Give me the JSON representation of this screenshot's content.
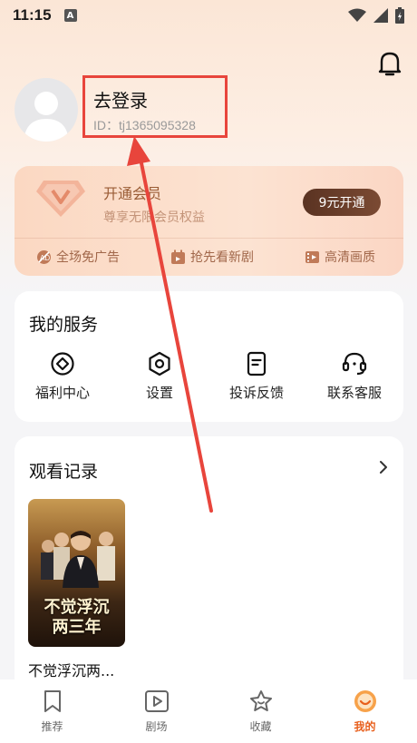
{
  "status": {
    "time": "11:15",
    "sim": "A"
  },
  "profile": {
    "login_label": "去登录",
    "user_id": "ID：tj1365095328"
  },
  "vip": {
    "title": "开通会员",
    "subtitle": "尊享无限会员权益",
    "button": "9元开通",
    "perks": [
      {
        "label": "全场免广告",
        "icon": "no-ads-icon"
      },
      {
        "label": "抢先看新剧",
        "icon": "calendar-icon"
      },
      {
        "label": "高清画质",
        "icon": "film-icon"
      }
    ]
  },
  "services": {
    "title": "我的服务",
    "items": [
      {
        "label": "福利中心",
        "icon": "diamond-icon"
      },
      {
        "label": "设置",
        "icon": "settings-hexagon-icon"
      },
      {
        "label": "投诉反馈",
        "icon": "document-icon"
      },
      {
        "label": "联系客服",
        "icon": "headset-icon"
      }
    ]
  },
  "history": {
    "title": "观看记录",
    "items": [
      {
        "name": "不觉浮沉两...",
        "poster_line1": "不觉浮沉",
        "poster_line2": "两三年"
      }
    ]
  },
  "tabbar": {
    "tabs": [
      {
        "label": "推荐",
        "icon": "bookmark-icon"
      },
      {
        "label": "剧场",
        "icon": "play-icon"
      },
      {
        "label": "收藏",
        "icon": "star-icon"
      },
      {
        "label": "我的",
        "icon": "profile-icon",
        "active": true
      }
    ]
  },
  "colors": {
    "accent": "#e85f1c",
    "highlight": "#e8453c",
    "vip_text": "#9a5c35"
  }
}
